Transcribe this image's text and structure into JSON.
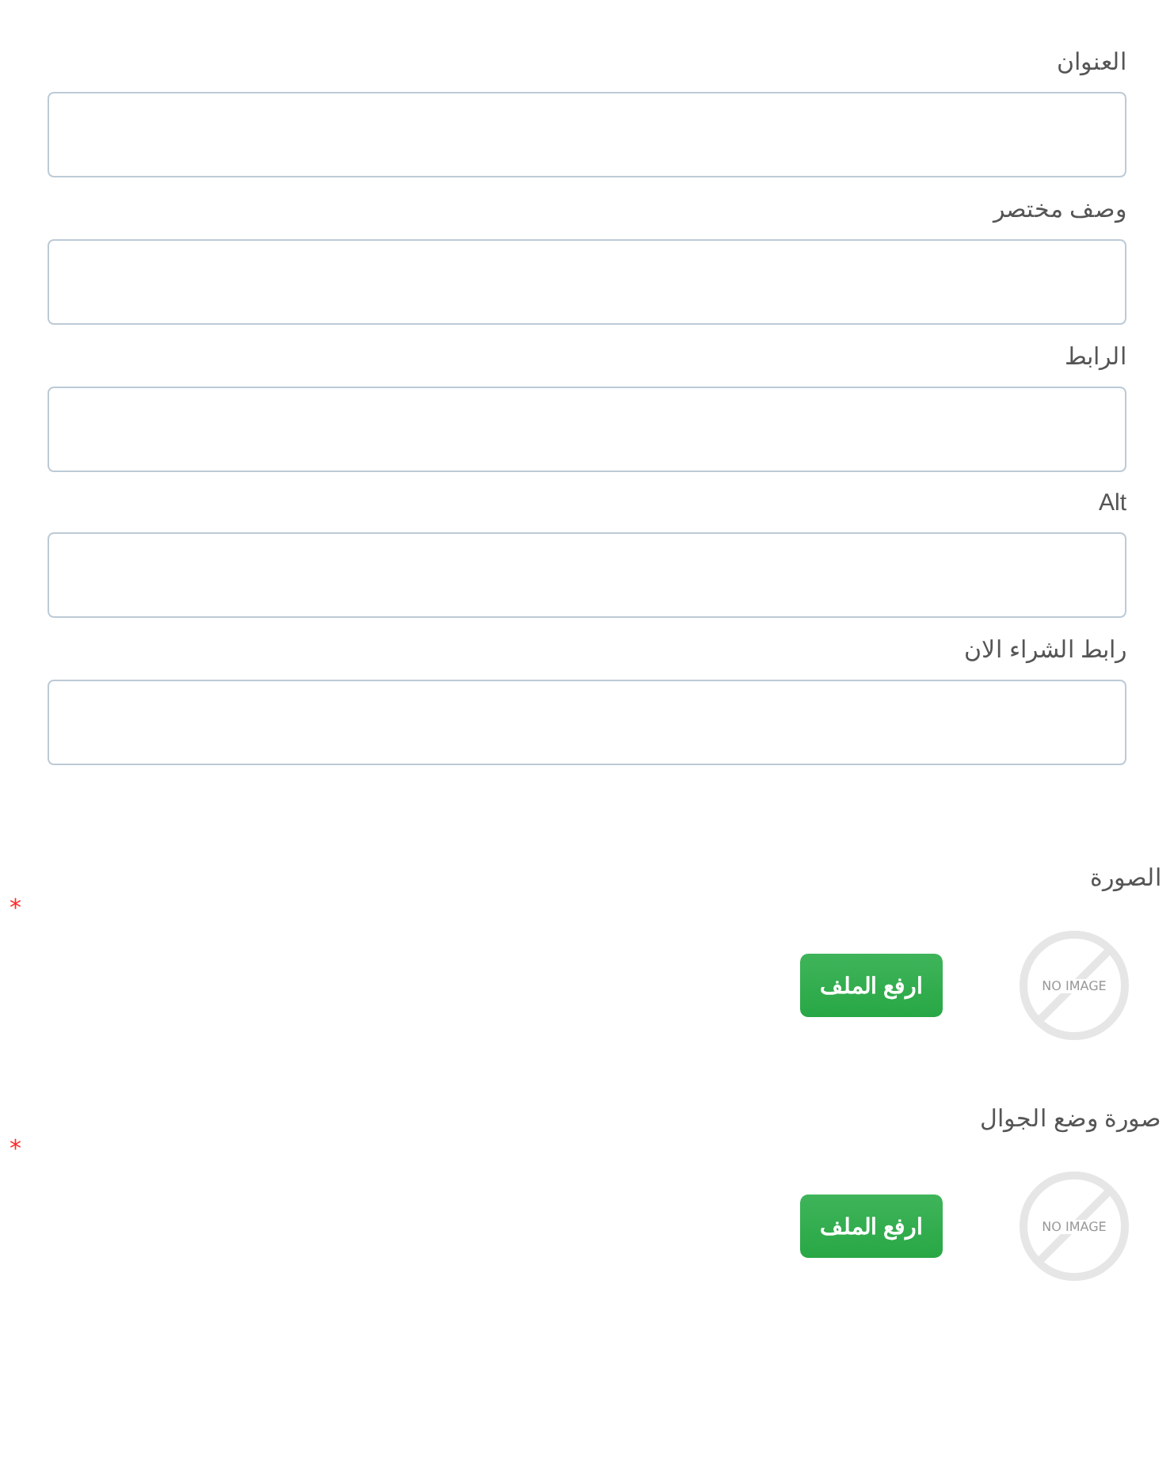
{
  "fields": [
    {
      "label": "العنوان"
    },
    {
      "label": "وصف مختصر"
    },
    {
      "label": "الرابط"
    },
    {
      "label": "Alt"
    },
    {
      "label": "رابط الشراء الان"
    }
  ],
  "uploads": [
    {
      "label": "الصورة",
      "required_mark": "*",
      "placeholder_text": "NO IMAGE",
      "button": "ارفع الملف"
    },
    {
      "label": "صورة وضع الجوال",
      "required_mark": "*",
      "placeholder_text": "NO IMAGE",
      "button": "ارفع الملف"
    }
  ]
}
